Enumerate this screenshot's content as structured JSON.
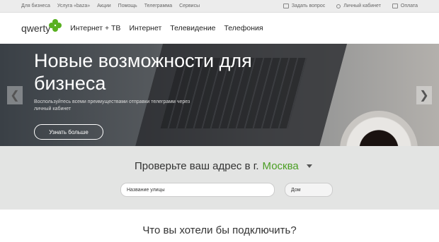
{
  "topbar": {
    "links": [
      "Для бизнеса",
      "Услуга «baza»",
      "Акции",
      "Помощь",
      "Телеграмма",
      "Сервисы"
    ],
    "ask": "Задать вопрос",
    "cabinet": "Личный кабинет",
    "pay": "Оплата"
  },
  "nav": {
    "logo": "qwerty",
    "items": [
      "Интернет + ТВ",
      "Интернет",
      "Телевидение",
      "Телефония"
    ]
  },
  "hero": {
    "title": "Новые возможности для бизнеса",
    "text": "Воспользуйтесь всеми преимуществами отправки телеграмм через личный кабинет",
    "button": "Узнать больше",
    "prev": "❮",
    "next": "❯"
  },
  "address": {
    "question": "Проверьте ваш адрес в г.",
    "city": "Москва",
    "street_placeholder": "Название улицы",
    "house_placeholder": "Дом"
  },
  "bottom": {
    "question": "Что вы хотели бы подключить?"
  }
}
